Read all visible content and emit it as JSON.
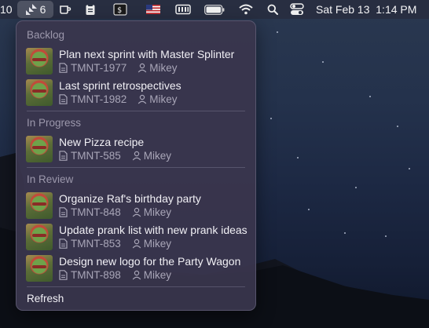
{
  "menubar": {
    "left_clip": "10",
    "jira_count": "6",
    "clock": "Sat Feb 13  1:14 PM",
    "icons": [
      "jira-icon",
      "coffee-cup-icon",
      "clipboard-icon",
      "terminal-icon",
      "us-flag-icon",
      "memory-icon",
      "battery-icon",
      "wifi-icon",
      "search-icon",
      "control-center-icon"
    ]
  },
  "panel": {
    "sections": [
      {
        "title": "Backlog",
        "items": [
          {
            "title": "Plan next sprint with Master Splinter",
            "key": "TMNT-1977",
            "assignee": "Mikey"
          },
          {
            "title": "Last sprint retrospectives",
            "key": "TMNT-1982",
            "assignee": "Mikey"
          }
        ]
      },
      {
        "title": "In Progress",
        "items": [
          {
            "title": "New Pizza recipe",
            "key": "TMNT-585",
            "assignee": "Mikey"
          }
        ]
      },
      {
        "title": "In Review",
        "items": [
          {
            "title": "Organize Raf's birthday party",
            "key": "TMNT-848",
            "assignee": "Mikey"
          },
          {
            "title": "Update prank list with new prank ideas",
            "key": "TMNT-853",
            "assignee": "Mikey"
          },
          {
            "title": "Design new logo for the Party Wagon",
            "key": "TMNT-898",
            "assignee": "Mikey"
          }
        ]
      }
    ],
    "refresh_label": "Refresh"
  },
  "colors": {
    "menubar_bg": "#282e40",
    "panel_bg": "#3a364e",
    "section_title": "#9c98ac",
    "meta_text": "#a9a6b8"
  }
}
